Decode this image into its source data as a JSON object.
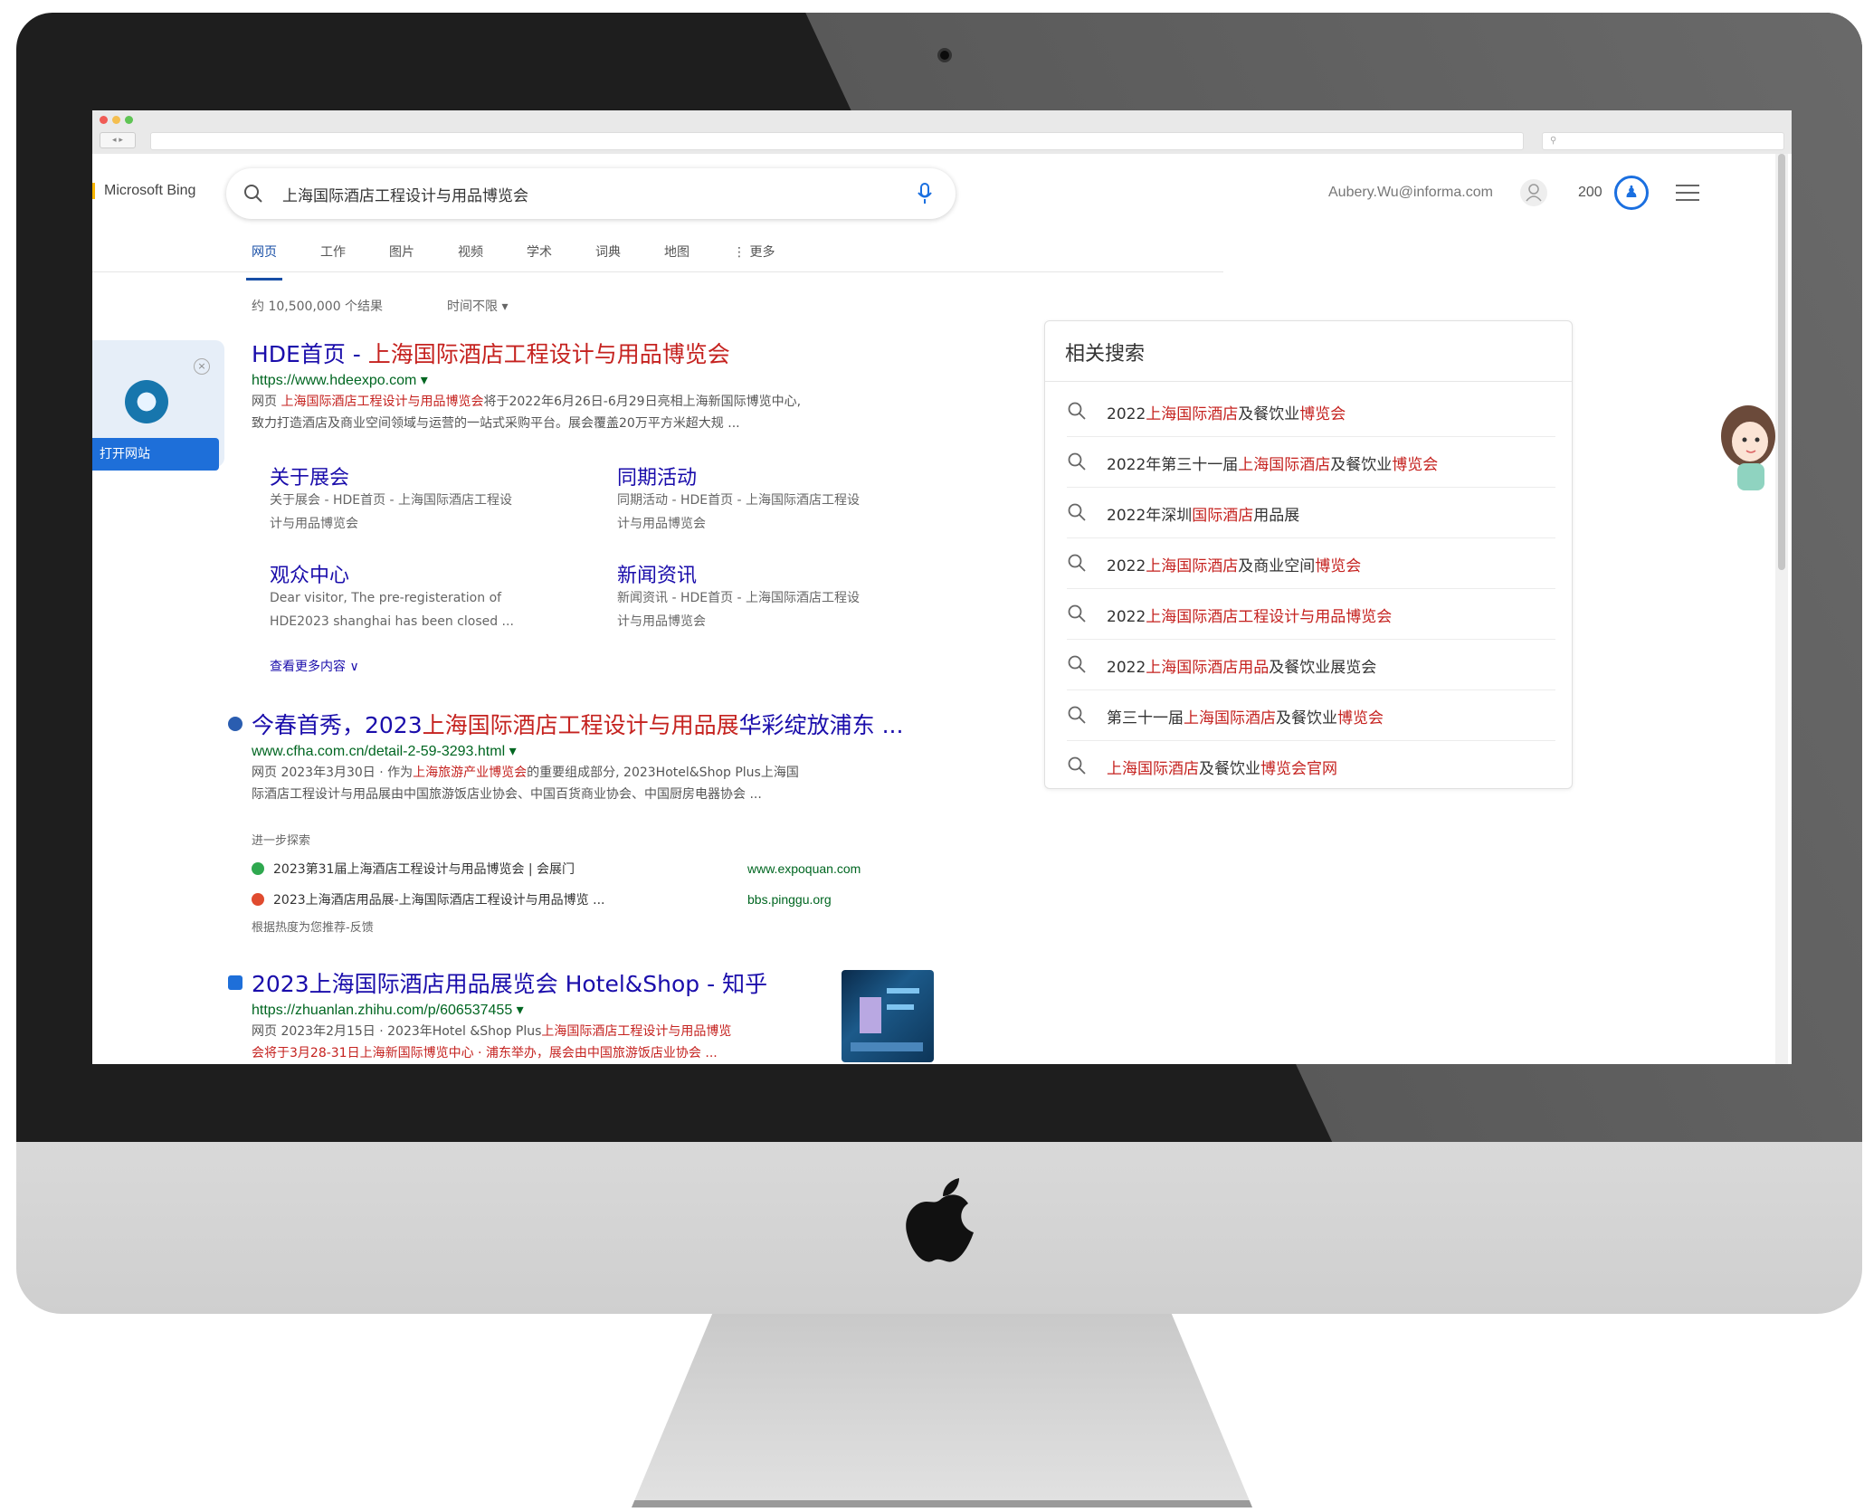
{
  "browser": {
    "nav_label": "◂ ▸"
  },
  "header": {
    "logo": "Microsoft Bing",
    "query": "上海国际酒店工程设计与用品博览会",
    "user": "Aubery.Wu@informa.com",
    "points": "200",
    "reward_glyph": "♟"
  },
  "tabs": [
    "网页",
    "工作",
    "图片",
    "视频",
    "学术",
    "词典",
    "地图",
    "⋮ 更多"
  ],
  "meta": {
    "result_count": "约 10,500,000 个结果",
    "time_filter": "时间不限 ▾"
  },
  "site_card": {
    "open_label": "打开网站",
    "close_glyph": "×"
  },
  "results": [
    {
      "title_plain": "HDE首页 - ",
      "title_hl": "上海国际酒店工程设计与用品博览会",
      "url": "https://www.hdeexpo.com ▾",
      "snippet_1_prefix": "网页 ",
      "snippet_1_hl": "上海国际酒店工程设计与用品博览会",
      "snippet_1_rest": "将于2022年6月26日-6月29日亮相上海新国际博览中心,",
      "snippet_2": "致力打造酒店及商业空间领域与运营的一站式采购平台。展会覆盖20万平方米超大规 ...",
      "sublinks": [
        {
          "title": "关于展会",
          "desc_1": "关于展会 - HDE首页 - 上海国际酒店工程设",
          "desc_2": "计与用品博览会"
        },
        {
          "title": "同期活动",
          "desc_1": "同期活动 - HDE首页 - 上海国际酒店工程设",
          "desc_2": "计与用品博览会"
        },
        {
          "title": "观众中心",
          "desc_1": "Dear visitor, The pre-registeration of",
          "desc_2": "HDE2023 shanghai has been closed ..."
        },
        {
          "title": "新闻资讯",
          "desc_1": "新闻资讯 - HDE首页 - 上海国际酒店工程设",
          "desc_2": "计与用品博览会"
        }
      ],
      "more": "查看更多内容 ∨"
    },
    {
      "title_plain": "今春首秀，2023",
      "title_hl": "上海国际酒店工程设计与用品展",
      "title_rest": "华彩绽放浦东 ...",
      "url": "www.cfha.com.cn/detail-2-59-3293.html ▾",
      "snippet_1_prefix": "网页 2023年3月30日 · 作为",
      "snippet_1_hl": "上海旅游产业博览会",
      "snippet_1_rest": "的重要组成部分, 2023Hotel&Shop Plus上海国",
      "snippet_2": "际酒店工程设计与用品展由中国旅游饭店业协会、中国百货商业协会、中国厨房电器协会 ...",
      "further_label": "进一步探索",
      "further": [
        {
          "text": "2023第31届上海酒店工程设计与用品博览会 | 会展门",
          "domain": "www.expoquan.com"
        },
        {
          "text": "2023上海酒店用品展-上海国际酒店工程设计与用品博览 ...",
          "domain": "bbs.pinggu.org"
        }
      ],
      "further_note": "根据热度为您推荐-反馈"
    },
    {
      "title_plain": "2023上海国际酒店用品展览会 Hotel&Shop - 知乎",
      "url": "https://zhuanlan.zhihu.com/p/606537455 ▾",
      "snippet_1_prefix": "网页 2023年2月15日 · 2023年Hotel &Shop Plus",
      "snippet_1_hl": "上海国际酒店工程设计与用品博览",
      "snippet_2": "会将于3月28-31日上海新国际博览中心 · 浦东举办，展会由中国旅游饭店业协会 ..."
    }
  ],
  "related": {
    "title": "相关搜索",
    "items": [
      {
        "pre": "2022",
        "hl": "上海国际酒店",
        "post": "及餐饮业",
        "hl2": "博览会"
      },
      {
        "pre": "2022年第三十一届",
        "hl": "上海国际酒店",
        "post": "及餐饮业",
        "hl2": "博览会"
      },
      {
        "pre": "2022年深圳",
        "hl": "国际酒店",
        "post": "用品展",
        "hl2": ""
      },
      {
        "pre": "2022",
        "hl": "上海国际酒店",
        "post": "及商业空间",
        "hl2": "博览会"
      },
      {
        "pre": "2022",
        "hl": "上海国际酒店工程设计与用品",
        "post": "",
        "hl2": "博览会"
      },
      {
        "pre": "2022",
        "hl": "上海国际酒店用品",
        "post": "及餐饮业展览会",
        "hl2": ""
      },
      {
        "pre": "第三十一届",
        "hl": "上海国际酒店",
        "post": "及餐饮业",
        "hl2": "博览会"
      },
      {
        "pre": "",
        "hl": "上海国际酒店",
        "post": "及餐饮业",
        "hl2": "博览会官网"
      }
    ]
  },
  "colors": {
    "link": "#1a0dab",
    "highlight": "#c5221f",
    "url": "#006621",
    "accent": "#1e6fd9"
  }
}
